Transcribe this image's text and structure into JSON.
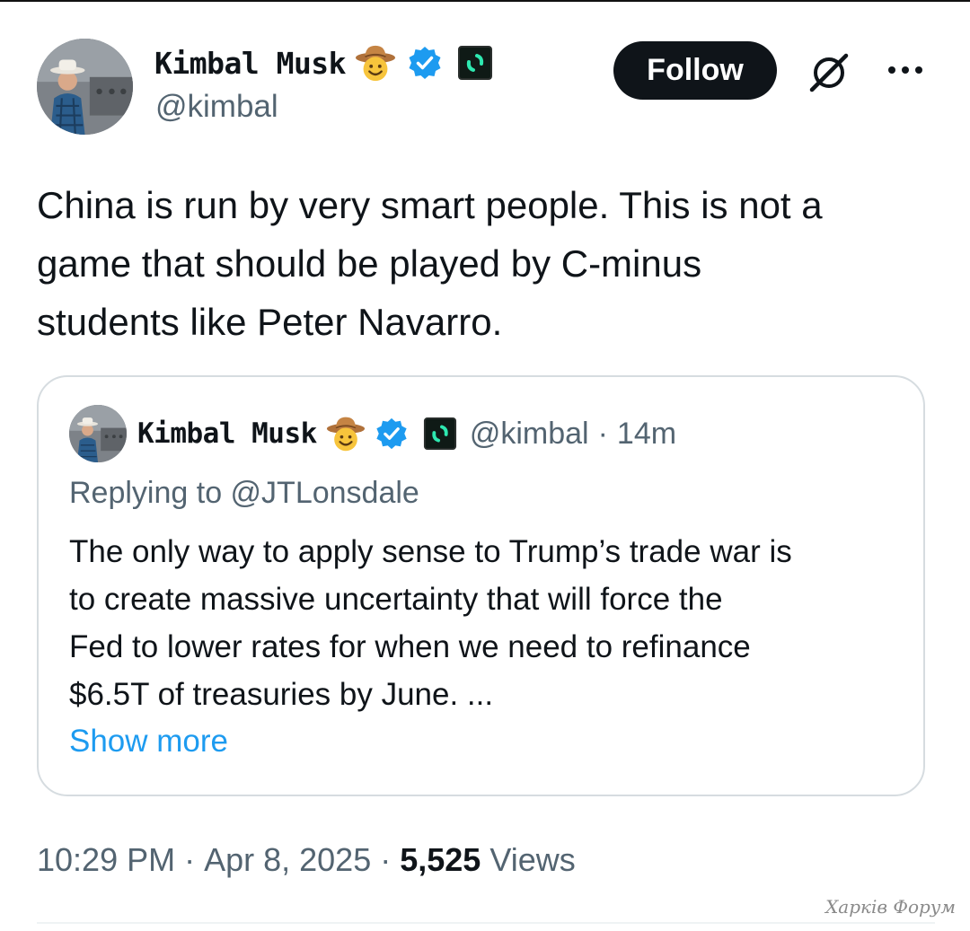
{
  "author": {
    "display_name": "Kimbal Musk",
    "handle": "@kimbal",
    "badge_emoji": "cowboy-hat-face",
    "verified": true,
    "affiliate_badge": "affiliate-icon"
  },
  "header": {
    "follow_label": "Follow",
    "grok_icon": "grok-icon",
    "more_icon": "more-icon"
  },
  "tweet": {
    "text": "China is run by very smart people. This is not a\ngame that should be played by C-minus\nstudents like Peter Navarro."
  },
  "quote": {
    "display_name": "Kimbal Musk",
    "handle": "@kimbal",
    "separator": "·",
    "time": "14m",
    "replying_to": "Replying to @JTLonsdale",
    "text": "The only way to apply sense to Trump’s trade war is\nto create massive uncertainty that will force the\nFed to lower rates for when we need to refinance\n$6.5T of treasuries by June. ...",
    "show_more": "Show more"
  },
  "meta": {
    "time": "10:29 PM",
    "separator": "·",
    "date": "Apr 8, 2025",
    "views_count": "5,525",
    "views_label": "Views"
  },
  "watermark": "Харків Форум",
  "colors": {
    "text": "#0f1419",
    "secondary": "#536471",
    "link": "#1d9bf0",
    "verified": "#1d9bf0",
    "button_bg": "#0f1419",
    "border": "#d6dce0"
  }
}
